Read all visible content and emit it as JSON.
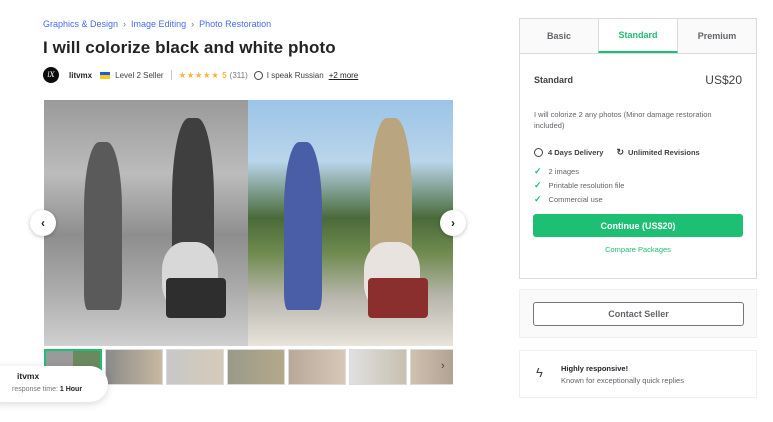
{
  "breadcrumb": [
    "Graphics & Design",
    "Image Editing",
    "Photo Restoration"
  ],
  "gig": {
    "title": "I will colorize black and white photo"
  },
  "seller": {
    "avatar_letters": "lX",
    "name": "litvmx",
    "level": "Level 2 Seller",
    "stars": "★★★★★",
    "rating": "5",
    "reviews": "(311)",
    "language": "I speak Russian",
    "more_languages": "+2 more",
    "flag_colors": [
      "#1e5bd6",
      "#f5cd1b"
    ]
  },
  "gallery": {
    "prev_icon": "‹",
    "next_icon": "›",
    "thumb_arrow": "›",
    "thumb_count": 7
  },
  "chip": {
    "name": "itvmx",
    "response_label": "response time:",
    "response_value": "1 Hour"
  },
  "packages": {
    "tabs": [
      "Basic",
      "Standard",
      "Premium"
    ],
    "active_tab": "Standard",
    "name": "Standard",
    "price": "US$20",
    "description": "I will colorize 2 any photos (Minor damage restoration included)",
    "delivery": "4 Days Delivery",
    "revisions": "Unlimited Revisions",
    "features": [
      "2 images",
      "Printable resolution file",
      "Commercial use"
    ],
    "continue_label": "Continue (US$20)",
    "compare_label": "Compare Packages"
  },
  "contact": {
    "label": "Contact Seller"
  },
  "responsive": {
    "title": "Highly responsive!",
    "subtitle": "Known for exceptionally quick replies"
  },
  "colors": {
    "accent": "#1dbf73",
    "link": "#446ee7",
    "star": "#ffb33e"
  }
}
